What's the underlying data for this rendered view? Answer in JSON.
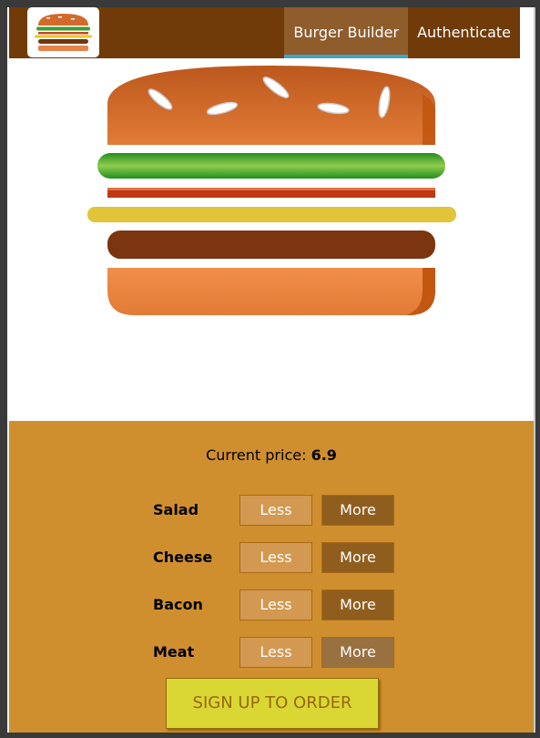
{
  "toolbar": {
    "nav": [
      {
        "label": "Burger Builder",
        "active": true
      },
      {
        "label": "Authenticate",
        "active": false
      }
    ]
  },
  "build_controls": {
    "price_label": "Current price:",
    "price_value": "6.9",
    "less_label": "Less",
    "more_label": "More",
    "ingredients": [
      {
        "label": "Salad"
      },
      {
        "label": "Cheese"
      },
      {
        "label": "Bacon"
      },
      {
        "label": "Meat"
      }
    ],
    "order_label": "SIGN UP TO ORDER"
  },
  "colors": {
    "toolbar_bg": "#703b09",
    "nav_active_bg": "#8f5c2c",
    "nav_active_border": "#40a4c8",
    "controls_bg": "#cf8f2e",
    "order_bg": "#dad735",
    "order_text": "#966909"
  },
  "icons": {
    "logo": "burger-logo-icon"
  }
}
